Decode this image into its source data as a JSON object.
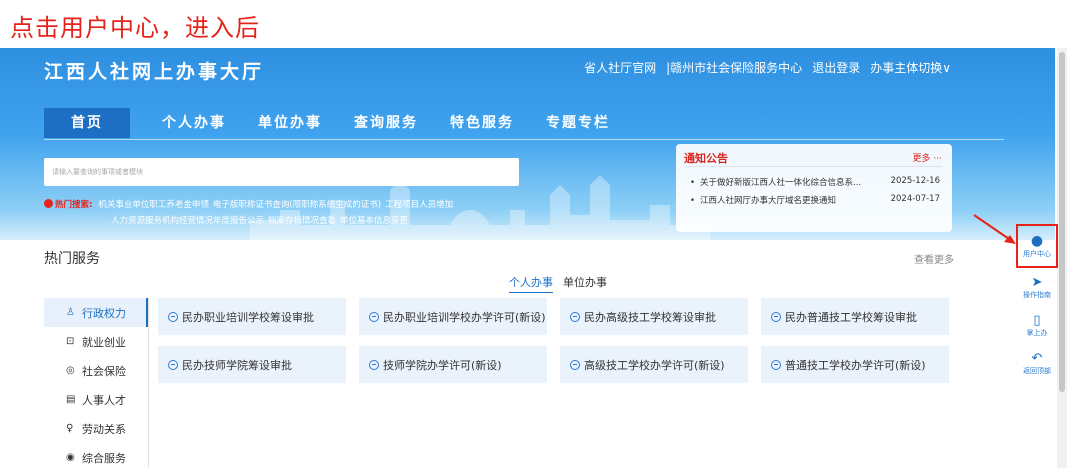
{
  "instruction": "点击用户中心，进入后",
  "header": {
    "title": "江西人社网上办事大厅",
    "top_links": [
      "省人社厅官网",
      "|赣州市社会保险服务中心",
      "退出登录",
      "办事主体切换∨"
    ]
  },
  "nav": {
    "items": [
      "首页",
      "个人办事",
      "单位办事",
      "查询服务",
      "特色服务",
      "专题专栏"
    ],
    "active": "首页"
  },
  "search": {
    "placeholder": "请输入要查询的事项或者模块"
  },
  "hot_search": {
    "label": "热门搜索:",
    "items_row1": [
      "机关事业单位职工养老金申领",
      "电子版职称证书查询(限职称系统生成的证书)",
      "工程项目人员增加"
    ],
    "items_row2": [
      "人力资源服务机构经营情况年度报告公示",
      "档案存档情况查看",
      "单位基本信息变更"
    ]
  },
  "notice": {
    "title": "通知公告",
    "more": "更多 ···",
    "items": [
      {
        "text": "关于做好新版江西人社一体化综合信息系...",
        "date": "2025-12-16"
      },
      {
        "text": "江西人社网厅办事大厅域名更换通知",
        "date": "2024-07-17"
      }
    ]
  },
  "hot_services": {
    "title": "热门服务",
    "view_more": "查看更多",
    "tabs": [
      "个人办事",
      "单位办事"
    ],
    "active_tab": "个人办事"
  },
  "side_menu": [
    {
      "icon": "law-icon",
      "glyph": "♙",
      "label": "行政权力"
    },
    {
      "icon": "briefcase-icon",
      "glyph": "⊡",
      "label": "就业创业"
    },
    {
      "icon": "shield-icon",
      "glyph": "◎",
      "label": "社会保险"
    },
    {
      "icon": "document-icon",
      "glyph": "▤",
      "label": "人事人才"
    },
    {
      "icon": "person-icon",
      "glyph": "♀",
      "label": "劳动关系"
    },
    {
      "icon": "service-icon",
      "glyph": "◉",
      "label": "综合服务"
    }
  ],
  "service_cards": [
    "民办职业培训学校筹设审批",
    "民办职业培训学校办学许可(新设)",
    "民办高级技工学校筹设审批",
    "民办普通技工学校筹设审批",
    "民办技师学院筹设审批",
    "技师学院办学许可(新设)",
    "高级技工学校办学许可(新设)",
    "普通技工学校办学许可(新设)"
  ],
  "toolbar": [
    {
      "icon": "user-center-icon",
      "glyph": "●",
      "label": "用户中心"
    },
    {
      "icon": "paper-plane-icon",
      "glyph": "➤",
      "label": "操作指南"
    },
    {
      "icon": "mobile-icon",
      "glyph": "▯",
      "label": "掌上办"
    },
    {
      "icon": "back-top-icon",
      "glyph": "↶",
      "label": "返回顶部"
    }
  ],
  "colors": {
    "accent": "#1d6fc4",
    "highlight": "#e5231b",
    "card_bg": "#eaf2fb"
  }
}
